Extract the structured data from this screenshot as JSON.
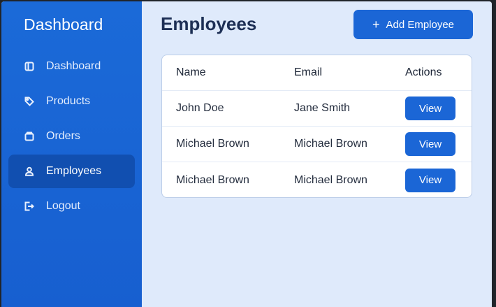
{
  "sidebar": {
    "title": "Dashboard",
    "items": [
      {
        "label": "Dashboard",
        "icon": "dashboard-icon",
        "active": false
      },
      {
        "label": "Products",
        "icon": "tag-icon",
        "active": false
      },
      {
        "label": "Orders",
        "icon": "box-icon",
        "active": false
      },
      {
        "label": "Employees",
        "icon": "user-icon",
        "active": true
      },
      {
        "label": "Logout",
        "icon": "logout-icon",
        "active": false
      }
    ]
  },
  "main": {
    "title": "Employees",
    "add_button_label": "Add Employee",
    "add_button_icon": "plus-icon",
    "table": {
      "columns": [
        "Name",
        "Email",
        "Actions"
      ],
      "rows": [
        {
          "name": "John Doe",
          "email": "Jane Smith",
          "action_label": "View"
        },
        {
          "name": "Michael Brown",
          "email": "Michael Brown",
          "action_label": "View"
        },
        {
          "name": "Michael Brown",
          "email": "Michael Brown",
          "action_label": "View"
        }
      ]
    }
  },
  "colors": {
    "sidebar_bg": "#1b6ad8",
    "sidebar_active": "#114fb0",
    "main_bg": "#dfeafb",
    "accent": "#1b66d6",
    "title_text": "#1d2f55"
  }
}
